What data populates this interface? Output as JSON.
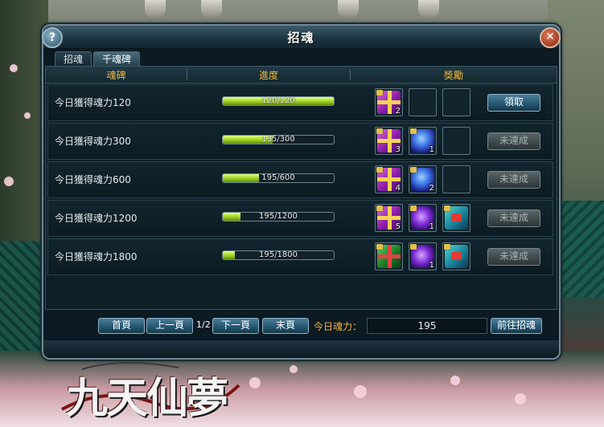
{
  "window": {
    "title": "招魂",
    "help_label": "?",
    "close_label": "✕"
  },
  "tabs": [
    {
      "label": "招魂",
      "active": false
    },
    {
      "label": "千魂碑",
      "active": true
    }
  ],
  "table": {
    "headers": [
      "魂碑",
      "進度",
      "獎勵"
    ],
    "rows": [
      {
        "label": "今日獲得魂力120",
        "progress_text": "120/120",
        "progress": 1.0,
        "rewards": [
          {
            "icon": "purple-gift-icon",
            "qty": "2"
          },
          null,
          null
        ],
        "button": "領取",
        "button_enabled": true
      },
      {
        "label": "今日獲得魂力300",
        "progress_text": "135/300",
        "progress": 0.45,
        "rewards": [
          {
            "icon": "purple-gift-icon",
            "qty": "3"
          },
          {
            "icon": "blue-potion-icon",
            "qty": "1"
          },
          null
        ],
        "button": "未達成",
        "button_enabled": false
      },
      {
        "label": "今日獲得魂力600",
        "progress_text": "195/600",
        "progress": 0.325,
        "rewards": [
          {
            "icon": "purple-gift-icon",
            "qty": "4"
          },
          {
            "icon": "blue-potion-icon",
            "qty": "2"
          },
          null
        ],
        "button": "未達成",
        "button_enabled": false
      },
      {
        "label": "今日獲得魂力1200",
        "progress_text": "195/1200",
        "progress": 0.1625,
        "rewards": [
          {
            "icon": "purple-gift-icon",
            "qty": "5"
          },
          {
            "icon": "violet-potion-icon",
            "qty": "1"
          },
          {
            "icon": "treasure-chest-icon",
            "qty": ""
          }
        ],
        "button": "未達成",
        "button_enabled": false
      },
      {
        "label": "今日獲得魂力1800",
        "progress_text": "195/1800",
        "progress": 0.108,
        "rewards": [
          {
            "icon": "green-gift-icon",
            "qty": ""
          },
          {
            "icon": "violet-potion-icon",
            "qty": "1"
          },
          {
            "icon": "treasure-chest-icon",
            "qty": ""
          }
        ],
        "button": "未達成",
        "button_enabled": false
      }
    ]
  },
  "footer": {
    "first_page": "首頁",
    "prev_page": "上一頁",
    "page_info": "1/2",
    "next_page": "下一頁",
    "last_page": "末頁",
    "soul_label": "今日魂力：",
    "soul_value": "195",
    "go_button": "前往招魂"
  },
  "logo": {
    "text": "九天仙夢"
  },
  "colors": {
    "accent": "#f0b63c",
    "progress": "#9fd021",
    "panel": "#0e1f28"
  }
}
